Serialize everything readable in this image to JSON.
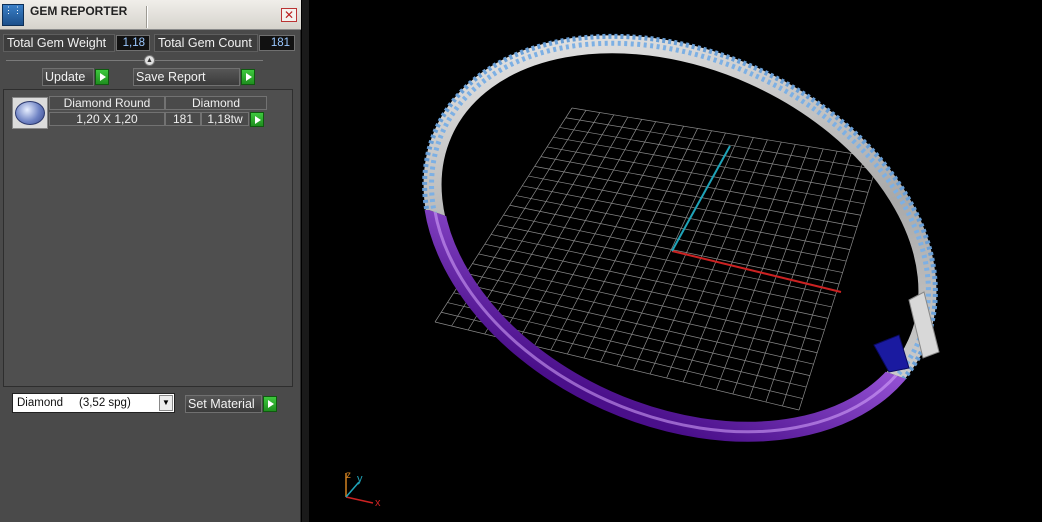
{
  "window": {
    "title": "GEM REPORTER",
    "close_symbol": "✕",
    "app_icon": "gem-reporter-app-icon",
    "app_icon_glyph": "⋮⋮"
  },
  "stats": {
    "weight_label": "Total Gem Weight",
    "weight_value": "1,18",
    "count_label": "Total Gem Count",
    "count_value": "181"
  },
  "toolbar": {
    "update_label": "Update",
    "save_report_label": "Save Report"
  },
  "gems": [
    {
      "shape": "Diamond Round",
      "material": "Diamond",
      "size": "1,20 X 1,20",
      "count": "181",
      "weight": "1,18tw"
    }
  ],
  "material": {
    "selected": "Diamond     (3,52 spg)",
    "set_label": "Set Material"
  },
  "viewport": {
    "axis_z": "z",
    "axis_y": "y",
    "axis_x": "x",
    "colors": {
      "band_purple": "#8a2be2",
      "band_silver": "#c8c8c8",
      "gem_blue": "#6aa0d8",
      "grid": "#8a8a8a",
      "axis_x": "#cc2222",
      "axis_y": "#1fa3b8",
      "axis_z": "#d08020"
    }
  }
}
